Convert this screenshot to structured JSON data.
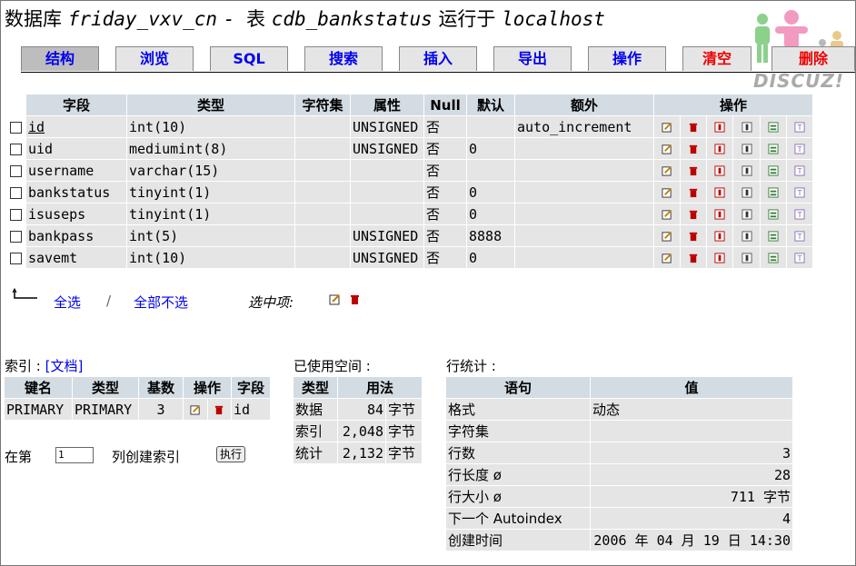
{
  "title": {
    "db_label": "数据库",
    "db_name": "friday_vxv_cn",
    "sep": " - ",
    "table_label": "表",
    "table_name": "cdb_bankstatus",
    "running_on": "运行于",
    "host": "localhost"
  },
  "tabs": [
    "结构",
    "浏览",
    "SQL",
    "搜索",
    "插入",
    "导出",
    "操作",
    "清空",
    "删除"
  ],
  "logo_text": "DISCUZ!",
  "fields": {
    "headers": [
      "字段",
      "类型",
      "字符集",
      "属性",
      "Null",
      "默认",
      "额外",
      "操作"
    ],
    "rows": [
      {
        "name": "id",
        "type": "int(10)",
        "charset": "",
        "attr": "UNSIGNED",
        "null": "否",
        "default": "",
        "extra": "auto_increment"
      },
      {
        "name": "uid",
        "type": "mediumint(8)",
        "charset": "",
        "attr": "UNSIGNED",
        "null": "否",
        "default": "0",
        "extra": ""
      },
      {
        "name": "username",
        "type": "varchar(15)",
        "charset": "",
        "attr": "",
        "null": "否",
        "default": "",
        "extra": ""
      },
      {
        "name": "bankstatus",
        "type": "tinyint(1)",
        "charset": "",
        "attr": "",
        "null": "否",
        "default": "0",
        "extra": ""
      },
      {
        "name": "isuseps",
        "type": "tinyint(1)",
        "charset": "",
        "attr": "",
        "null": "否",
        "default": "0",
        "extra": ""
      },
      {
        "name": "bankpass",
        "type": "int(5)",
        "charset": "",
        "attr": "UNSIGNED",
        "null": "否",
        "default": "8888",
        "extra": ""
      },
      {
        "name": "savemt",
        "type": "int(10)",
        "charset": "",
        "attr": "UNSIGNED",
        "null": "否",
        "default": "0",
        "extra": ""
      }
    ]
  },
  "selection": {
    "select_all": "全选",
    "separator": "/",
    "deselect_all": "全部不选",
    "with_selected": "选中项:"
  },
  "indexes": {
    "label": "索引 :",
    "doc_link": "[文档]",
    "headers": [
      "键名",
      "类型",
      "基数",
      "操作",
      "字段"
    ],
    "rows": [
      {
        "key": "PRIMARY",
        "type": "PRIMARY",
        "cardinality": "3",
        "field": "id"
      }
    ],
    "create_prefix": "在第",
    "create_value": "1",
    "create_suffix": "列创建索引",
    "go_button": "执行"
  },
  "space": {
    "label": "已使用空间 :",
    "headers": [
      "类型",
      "用法"
    ],
    "rows": [
      {
        "type": "数据",
        "value": "84",
        "unit": "字节"
      },
      {
        "type": "索引",
        "value": "2,048",
        "unit": "字节"
      },
      {
        "type": "统计",
        "value": "2,132",
        "unit": "字节"
      }
    ]
  },
  "row_stats": {
    "label": "行统计 :",
    "headers": [
      "语句",
      "值"
    ],
    "rows": [
      {
        "name": "格式",
        "value": "动态"
      },
      {
        "name": "字符集",
        "value": ""
      },
      {
        "name": "行数",
        "value": "3"
      },
      {
        "name": "行长度 ø",
        "value": "28"
      },
      {
        "name": "行大小  ø",
        "value": "711 字节"
      },
      {
        "name": "下一个 Autoindex",
        "value": "4"
      },
      {
        "name": "创建时间",
        "value": "2006 年 04 月 19 日 14:30"
      }
    ]
  }
}
